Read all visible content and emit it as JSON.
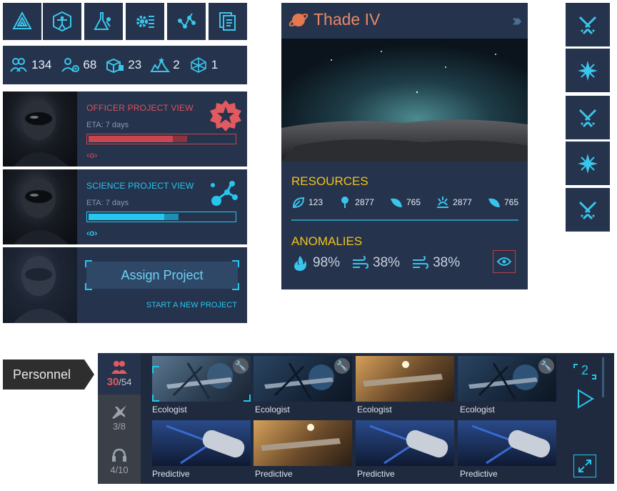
{
  "nav": {
    "items": [
      {
        "icon": "pyramid-icon"
      },
      {
        "icon": "vitruvian-icon"
      },
      {
        "icon": "flask-icon"
      },
      {
        "icon": "gear-list-icon"
      },
      {
        "icon": "network-icon"
      },
      {
        "icon": "documents-icon"
      }
    ]
  },
  "stats": [
    {
      "icon": "personnel-icon",
      "value": "134"
    },
    {
      "icon": "scientist-icon",
      "value": "68"
    },
    {
      "icon": "cargo-icon",
      "value": "23"
    },
    {
      "icon": "skyline-icon",
      "value": "2"
    },
    {
      "icon": "polyhedron-icon",
      "value": "1"
    }
  ],
  "projects": {
    "officer": {
      "title": "OFFICER PROJECT VIEW",
      "eta": "ETA: 7 days",
      "progress": 0.58,
      "color": "#d9535a"
    },
    "science": {
      "title": "SCIENCE PROJECT VIEW",
      "eta": "ETA: 7 days",
      "progress": 0.52,
      "color": "#26c6ee"
    },
    "assign": {
      "button": "Assign Project",
      "link": "START A NEW PROJECT"
    }
  },
  "planet": {
    "name": "Thade IV",
    "resources_title": "RESOURCES",
    "resources": [
      "123",
      "2877",
      "765",
      "2877",
      "765"
    ],
    "anomalies_title": "ANOMALIES",
    "anomalies": [
      "98%",
      "38%",
      "38%"
    ]
  },
  "side": {
    "items": [
      "crossed-swords-icon",
      "star-icon",
      "crossed-swords-icon",
      "star-icon",
      "crossed-swords-icon"
    ]
  },
  "personnel": {
    "tab_label": "Personnel",
    "counts": {
      "main_current": "30",
      "main_total": "/54",
      "jet": "3/8",
      "headset": "4/10"
    },
    "row1": [
      "Ecologist",
      "Ecologist",
      "Ecologist",
      "Ecologist"
    ],
    "row2": [
      "Predictive",
      "Predictive",
      "Predictive",
      "Predictive"
    ],
    "page": "2"
  },
  "colors": {
    "panel": "#26334c",
    "accent_blue": "#26c6ee",
    "accent_red": "#d9535a",
    "accent_yellow": "#f0c419"
  }
}
